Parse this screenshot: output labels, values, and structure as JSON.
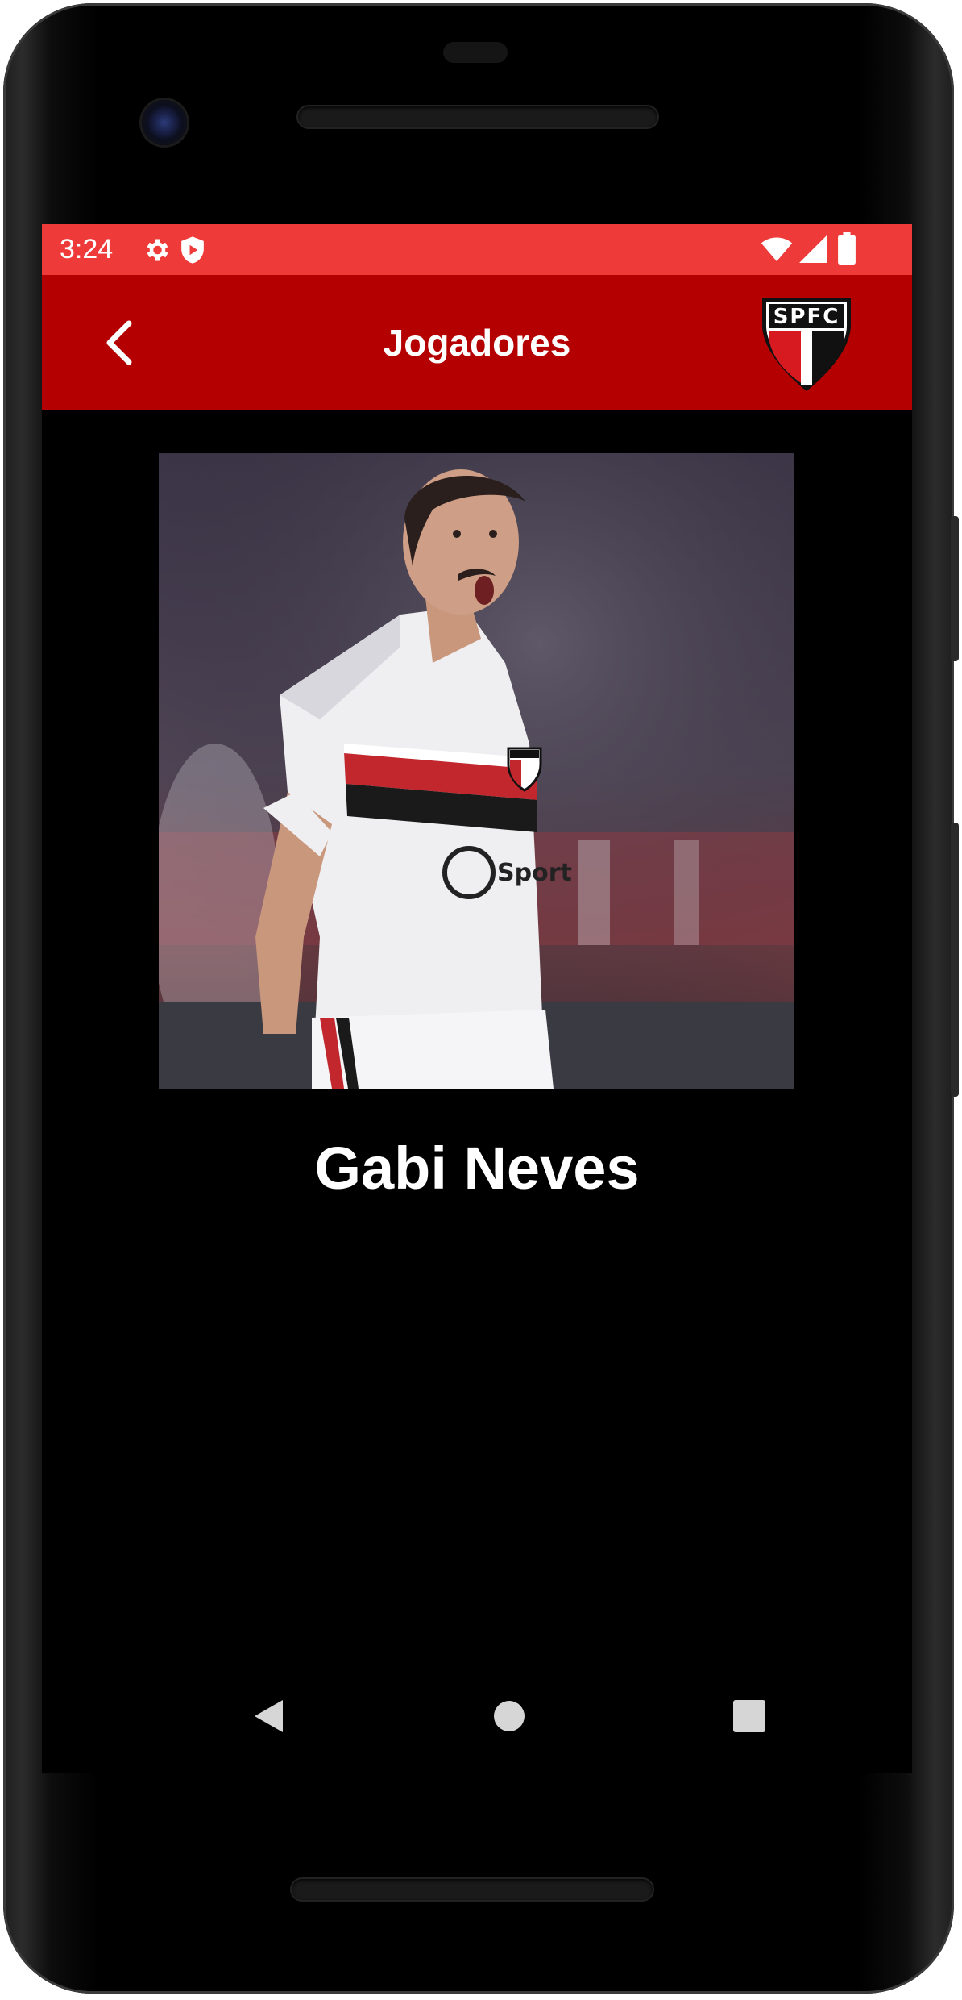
{
  "status_bar": {
    "time": "3:24",
    "background": "#ef3a3a",
    "left_icons": [
      "settings-icon",
      "shield-play-icon"
    ],
    "right_icons": [
      "wifi-icon",
      "cell-signal-icon",
      "battery-icon"
    ]
  },
  "toolbar": {
    "title": "Jogadores",
    "background": "#b40000",
    "back_icon": "chevron-left-icon",
    "logo_text": "SPFC"
  },
  "player": {
    "name": "Gabi Neves",
    "photo_description_icon": "player-photo"
  },
  "nav_bar": {
    "buttons": [
      "back-triangle-icon",
      "home-circle-icon",
      "recents-square-icon"
    ]
  }
}
